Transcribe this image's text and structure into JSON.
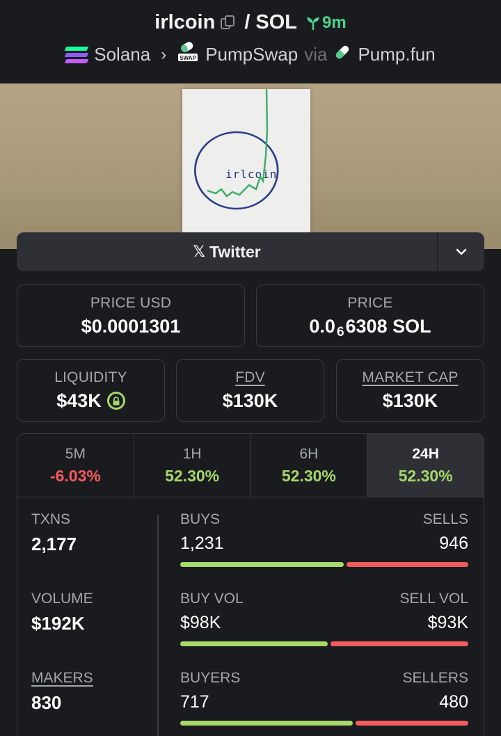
{
  "header": {
    "token": "irlcoin",
    "separator": "/",
    "quote": "SOL",
    "age": "9m",
    "chain": "Solana",
    "dex": "PumpSwap",
    "via_label": "via",
    "launchpad": "Pump.fun",
    "dex_badge": "SWAP"
  },
  "banner": {
    "paper_text": "irlcoin"
  },
  "social": {
    "twitter_label": "Twitter"
  },
  "price": {
    "usd_label": "PRICE USD",
    "usd_value": "$0.0001301",
    "native_label": "PRICE",
    "native_prefix": "0.0",
    "native_zeros": "6",
    "native_rest": "6308 SOL"
  },
  "stats": {
    "liquidity_label": "LIQUIDITY",
    "liquidity_value": "$43K",
    "fdv_label": "FDV",
    "fdv_value": "$130K",
    "mcap_label": "MARKET CAP",
    "mcap_value": "$130K"
  },
  "timeframes": [
    {
      "name": "5M",
      "change": "-6.03%"
    },
    {
      "name": "1H",
      "change": "52.30%"
    },
    {
      "name": "6H",
      "change": "52.30%"
    },
    {
      "name": "24H",
      "change": "52.30%"
    }
  ],
  "active_timeframe": "24H",
  "metrics": {
    "txns_label": "TXNS",
    "txns_value": "2,177",
    "volume_label": "VOLUME",
    "volume_value": "$192K",
    "makers_label": "MAKERS",
    "makers_value": "830"
  },
  "splits": {
    "buys_label": "BUYS",
    "buys_value": "1,231",
    "sells_label": "SELLS",
    "sells_value": "946",
    "buyvol_label": "BUY VOL",
    "buyvol_value": "$98K",
    "sellvol_label": "SELL VOL",
    "sellvol_value": "$93K",
    "buyers_label": "BUYERS",
    "buyers_value": "717",
    "sellers_label": "SELLERS",
    "sellers_value": "480"
  },
  "colors": {
    "background": "#1a1b1f",
    "positive": "#a6d86a",
    "negative": "#f25c5c",
    "age": "#4fd18b"
  }
}
